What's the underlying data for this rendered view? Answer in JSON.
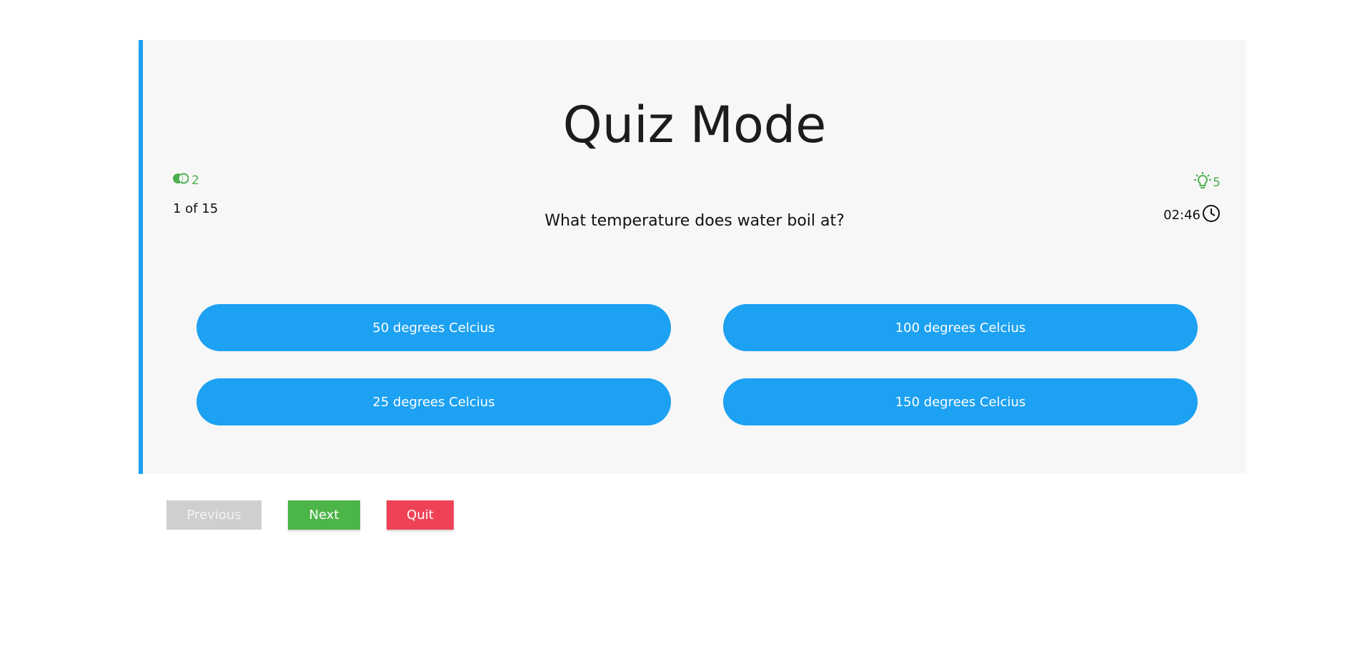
{
  "title": "Quiz Mode",
  "lifelines": {
    "count": "2",
    "icon": "fifty-fifty-icon",
    "color": "#4caf50"
  },
  "hints": {
    "count": "5",
    "icon": "lightbulb-icon",
    "color": "#4caf50"
  },
  "progress": {
    "text": "1 of 15",
    "current": 1,
    "total": 15
  },
  "timer": {
    "value": "02:46",
    "icon": "clock-icon"
  },
  "question": "What temperature does water boil at?",
  "options": [
    {
      "label": "50 degrees Celcius"
    },
    {
      "label": "100 degrees Celcius"
    },
    {
      "label": "25 degrees Celcius"
    },
    {
      "label": "150 degrees Celcius"
    }
  ],
  "buttons": {
    "previous": "Previous",
    "next": "Next",
    "quit": "Quit"
  },
  "colors": {
    "accent": "#1da1f2",
    "next": "#4cb548",
    "quit": "#ef4257",
    "disabled": "#cfcfcf"
  }
}
